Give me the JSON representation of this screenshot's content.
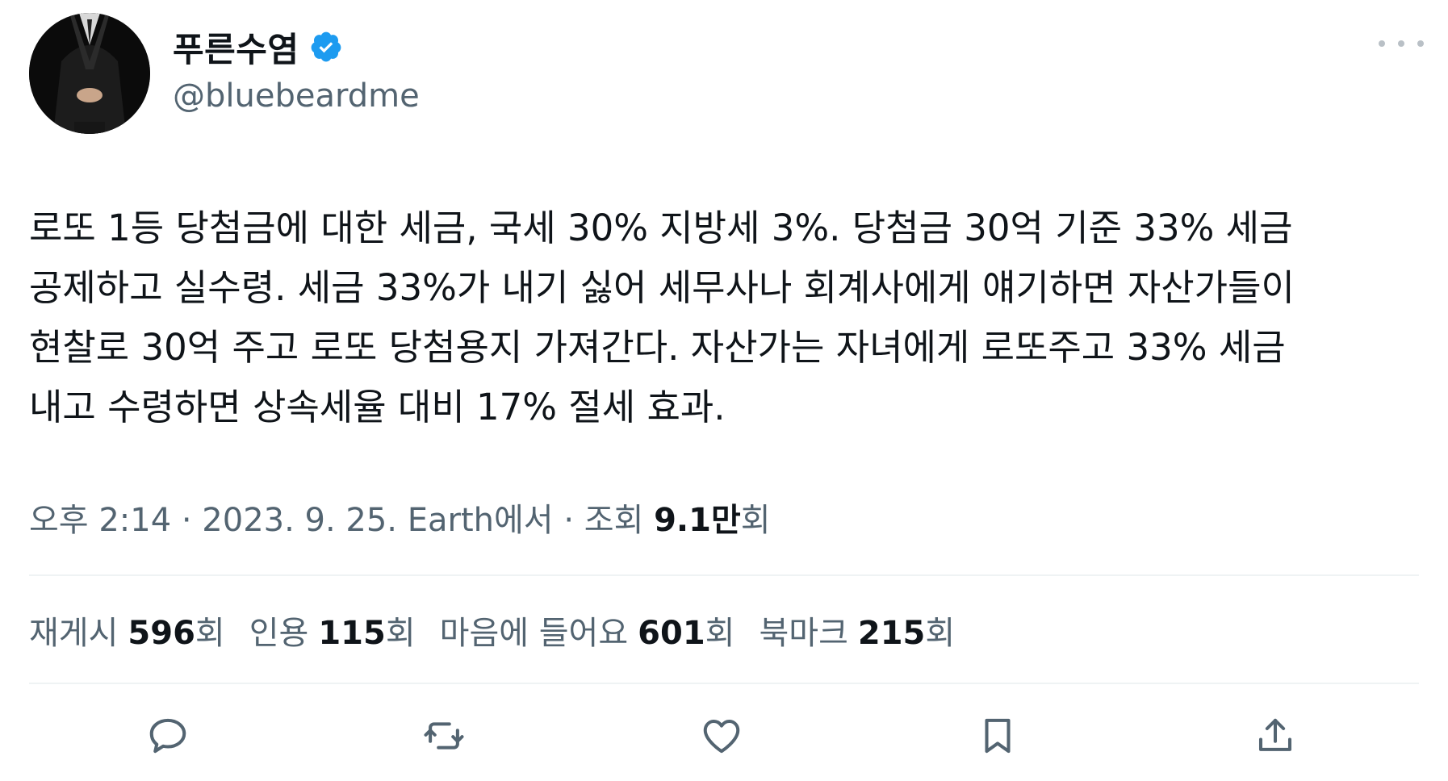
{
  "user": {
    "display_name": "푸른수염",
    "handle": "@bluebeardme",
    "verified": true
  },
  "tweet": {
    "text": "로또 1등 당첨금에 대한 세금, 국세 30% 지방세 3%. 당첨금 30억 기준 33% 세금\n공제하고 실수령. 세금 33%가 내기 싫어 세무사나 회계사에게 얘기하면 자산가들이\n현찰로 30억 주고 로또 당첨용지 가져간다. 자산가는 자녀에게 로또주고 33% 세금\n내고 수령하면 상속세율 대비 17% 절세 효과."
  },
  "meta": {
    "time": "오후 2:14",
    "separator": " · ",
    "date": "2023. 9. 25.",
    "source": "Earth에서",
    "views_label": "조회 ",
    "views_count": "9.1만",
    "views_unit": "회"
  },
  "stats": {
    "reposts_label": "재게시",
    "reposts_count": "596",
    "quotes_label": "인용",
    "quotes_count": "115",
    "likes_label": "마음에 들어요",
    "likes_count": "601",
    "bookmarks_label": "북마크",
    "bookmarks_count": "215",
    "unit": "회"
  },
  "actions": [
    {
      "name": "reply-icon"
    },
    {
      "name": "retweet-icon"
    },
    {
      "name": "like-icon"
    },
    {
      "name": "bookmark-icon"
    },
    {
      "name": "share-icon"
    }
  ],
  "colors": {
    "text_primary": "#0f1419",
    "text_secondary": "#536471",
    "verified_blue": "#1d9bf0",
    "divider": "#eff3f4"
  }
}
